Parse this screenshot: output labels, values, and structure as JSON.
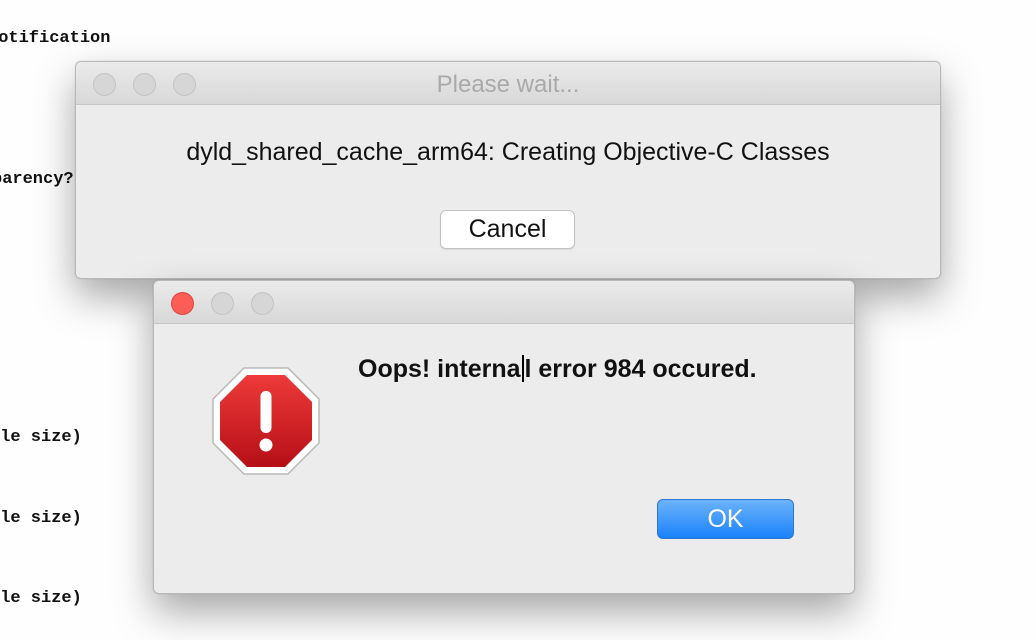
{
  "background": {
    "lines": [
      "Notification",
      "parency?",
      "ble size)",
      "ble size)",
      "ble size)"
    ]
  },
  "progress_window": {
    "title": "Please wait...",
    "message": "dyld_shared_cache_arm64: Creating Objective-C Classes",
    "cancel_label": "Cancel"
  },
  "alert_window": {
    "message_before_caret": "Oops! interna",
    "message_after_caret": "l error 984 occured.",
    "ok_label": "OK",
    "icon": "stop-alert-icon",
    "icon_symbol": "!"
  },
  "colors": {
    "close_button": "#fc5d57",
    "primary_button": "#1a82fb",
    "alert_red": "#c8141a"
  }
}
